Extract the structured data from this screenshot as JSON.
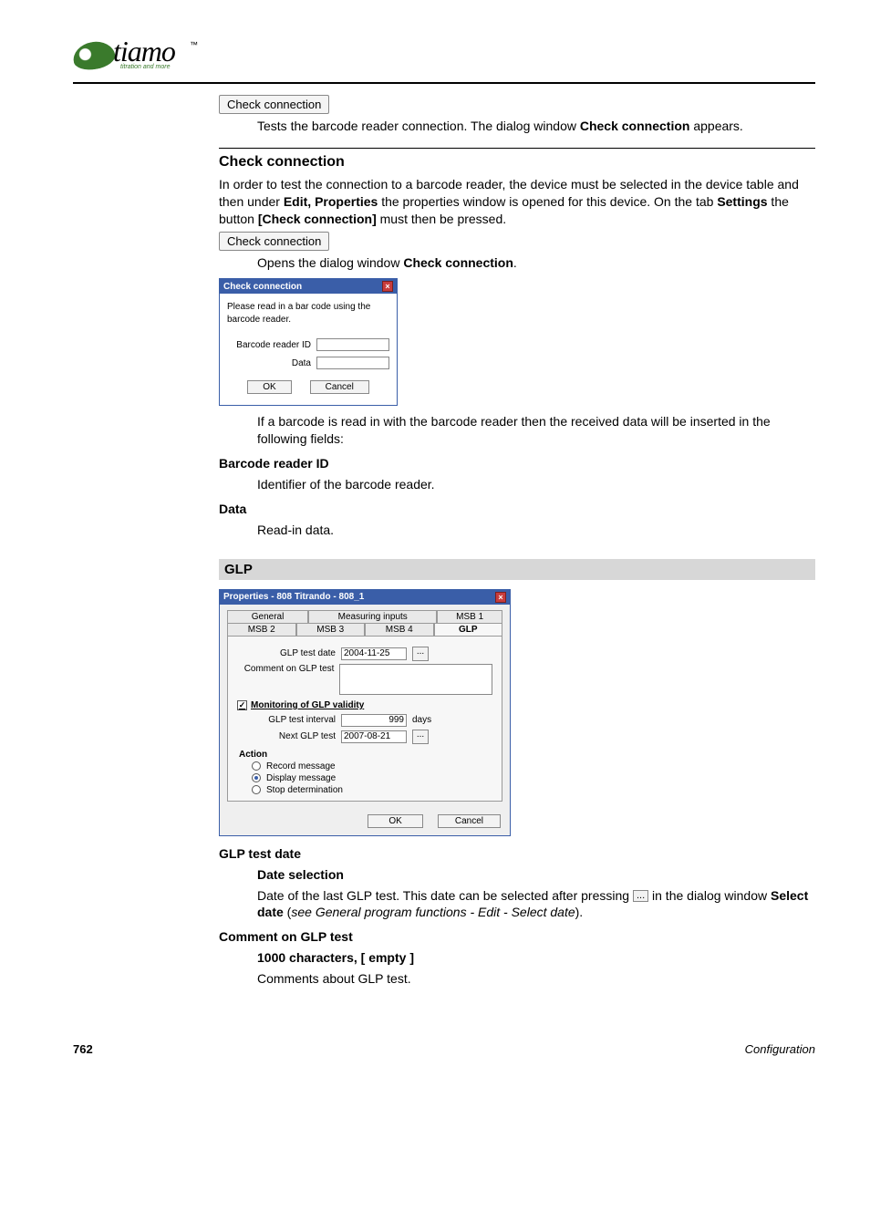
{
  "logo": {
    "text": "tiamo",
    "tm": "™",
    "sub": "titration and more"
  },
  "btn_check_conn_1": "Check connection",
  "desc_check_conn_1a": "Tests the barcode reader connection. The dialog window ",
  "desc_check_conn_1b": "Check connection",
  "desc_check_conn_1c": " appears.",
  "section_check_conn": "Check connection",
  "para_check_conn_a": "In order to test the connection to a barcode reader, the device must be selected in the device table and then under ",
  "para_check_conn_b": "Edit, Properties",
  "para_check_conn_c": " the properties window is opened for this device. On the tab ",
  "para_check_conn_d": "Settings",
  "para_check_conn_e": " the button ",
  "para_check_conn_f": "[Check connection]",
  "para_check_conn_g": " must then be pressed.",
  "btn_check_conn_2": "Check connection",
  "opens_dlg_a": "Opens the dialog window ",
  "opens_dlg_b": "Check connection",
  "opens_dlg_c": ".",
  "dlg1": {
    "title": "Check connection",
    "msg": "Please read in a bar code using the barcode reader.",
    "lbl_id": "Barcode reader ID",
    "lbl_data": "Data",
    "ok": "OK",
    "cancel": "Cancel"
  },
  "after_dlg1": "If a barcode is read in with the barcode reader then the received data will be inserted in the following fields:",
  "term_brid": "Barcode reader ID",
  "term_brid_desc": "Identifier of the barcode reader.",
  "term_data": "Data",
  "term_data_desc": "Read-in data.",
  "section_glp": "GLP",
  "dlg2": {
    "title": "Properties - 808 Titrando - 808_1",
    "tabs_row1": [
      "General",
      "Measuring inputs",
      "MSB 1"
    ],
    "tabs_row2": [
      "MSB 2",
      "MSB 3",
      "MSB 4",
      "GLP"
    ],
    "selected_tab": "GLP",
    "glp_test_date_lbl": "GLP test date",
    "glp_test_date_val": "2004-11-25",
    "comment_lbl": "Comment on GLP test",
    "monitoring_chk_label": "Monitoring of GLP validity",
    "monitoring_checked": true,
    "interval_lbl": "GLP test interval",
    "interval_val": "999",
    "interval_unit": "days",
    "next_lbl": "Next GLP test",
    "next_val": "2007-08-21",
    "action_title": "Action",
    "actions": [
      "Record message",
      "Display message",
      "Stop determination"
    ],
    "action_selected": "Display message",
    "ok": "OK",
    "cancel": "Cancel"
  },
  "def_glp_test_date": "GLP test date",
  "def_date_selection": "Date selection",
  "def_glp_test_date_a": "Date of the last GLP test. This date can be selected after pressing ",
  "def_glp_test_date_dots": "...",
  "def_glp_test_date_b": " in the dialog window ",
  "def_glp_test_date_c": "Select date",
  "def_glp_test_date_d": " (",
  "def_glp_test_date_e": "see General program functions - Edit - Select date",
  "def_glp_test_date_f": ").",
  "def_comment": "Comment on GLP test",
  "def_comment_sub": "1000 characters, [ empty ]",
  "def_comment_desc": "Comments about GLP test.",
  "footer": {
    "page": "762",
    "section": "Configuration"
  }
}
